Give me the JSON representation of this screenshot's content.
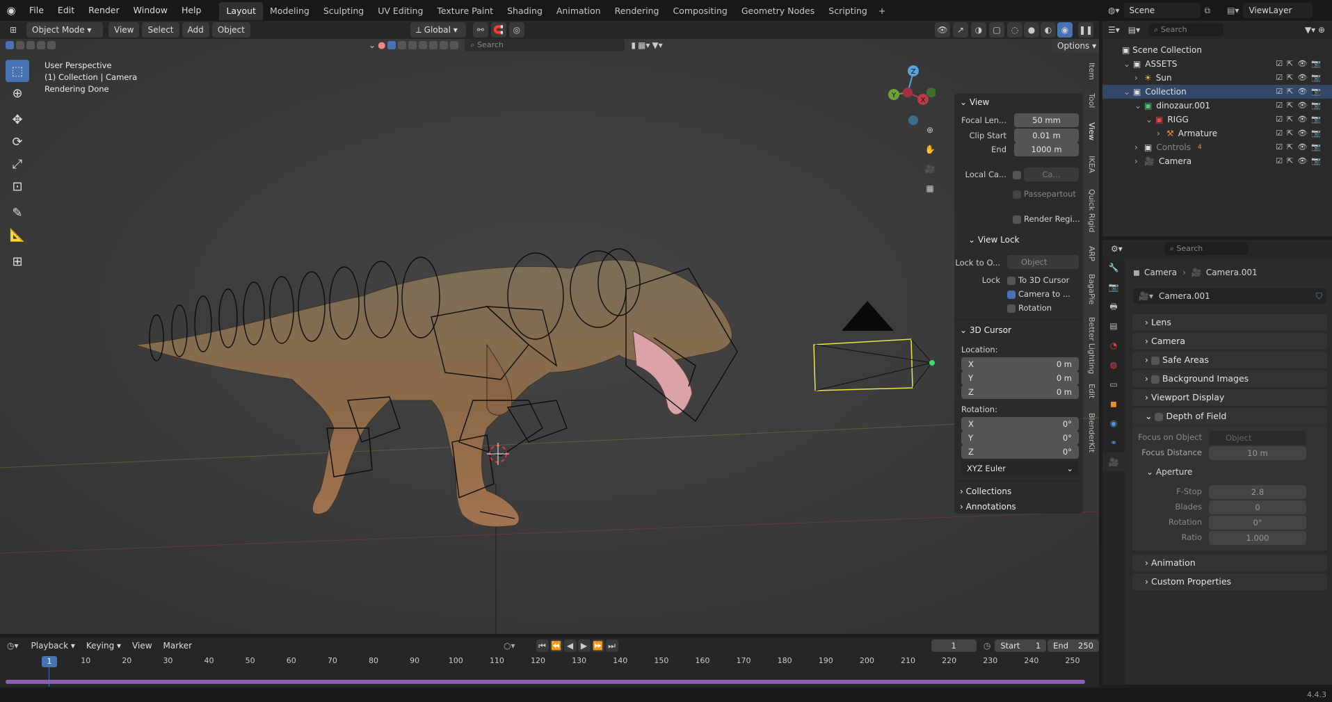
{
  "menu": {
    "items": [
      "File",
      "Edit",
      "Render",
      "Window",
      "Help"
    ]
  },
  "workspaces": [
    "Layout",
    "Modeling",
    "Sculpting",
    "UV Editing",
    "Texture Paint",
    "Shading",
    "Animation",
    "Rendering",
    "Compositing",
    "Geometry Nodes",
    "Scripting"
  ],
  "workspace_add": "+",
  "topright": {
    "scene": "Scene",
    "viewlayer": "ViewLayer"
  },
  "viewport_header": {
    "mode": "Object Mode",
    "menus": [
      "View",
      "Select",
      "Add",
      "Object"
    ],
    "orientation": "Global",
    "options": "Options",
    "search_placeholder": "Search"
  },
  "overlay_info": {
    "line1": "User Perspective",
    "line2": "(1) Collection | Camera",
    "line3": "Rendering Done"
  },
  "gizmo": {
    "z": "Z",
    "y": "Y",
    "x": "X"
  },
  "npanel": {
    "view_title": "View",
    "focal_label": "Focal Len...",
    "focal_value": "50 mm",
    "clip_start_label": "Clip Start",
    "clip_start_value": "0.01 m",
    "clip_end_label": "End",
    "clip_end_value": "1000 m",
    "local_cam_label": "Local Ca...",
    "local_cam_value": "Ca...",
    "passepartout": "Passepartout",
    "render_region": "Render Regi...",
    "view_lock_title": "View Lock",
    "lock_to_label": "Lock to O...",
    "lock_to_value": "Object",
    "lock_label": "Lock",
    "to_cursor": "To 3D Cursor",
    "camera_to": "Camera to ...",
    "rotation": "Rotation",
    "cursor_title": "3D Cursor",
    "location_label": "Location:",
    "loc_x_label": "X",
    "loc_x": "0 m",
    "loc_y_label": "Y",
    "loc_y": "0 m",
    "loc_z_label": "Z",
    "loc_z": "0 m",
    "rotation_label": "Rotation:",
    "rot_x_label": "X",
    "rot_x": "0°",
    "rot_y_label": "Y",
    "rot_y": "0°",
    "rot_z_label": "Z",
    "rot_z": "0°",
    "euler": "XYZ Euler",
    "collections": "Collections",
    "annotations": "Annotations"
  },
  "sidetabs": [
    "Item",
    "Tool",
    "View",
    "IKEA",
    "Quick Rigid",
    "ARP",
    "BagaPie",
    "Better Lighting",
    "Edit",
    "BlenderKit"
  ],
  "outliner": {
    "search_placeholder": "Search",
    "scene_collection": "Scene Collection",
    "items": [
      {
        "name": "ASSETS",
        "indent": 1
      },
      {
        "name": "Sun",
        "indent": 2
      },
      {
        "name": "Collection",
        "indent": 1
      },
      {
        "name": "dinozaur.001",
        "indent": 2
      },
      {
        "name": "RIGG",
        "indent": 3
      },
      {
        "name": "Armature",
        "indent": 4
      },
      {
        "name": "Controls",
        "indent": 2
      },
      {
        "name": "Camera",
        "indent": 2
      }
    ],
    "controls_count": "4"
  },
  "properties": {
    "search_placeholder": "Search",
    "breadcrumb_obj": "Camera",
    "breadcrumb_data": "Camera.001",
    "datablock": "Camera.001",
    "sections": [
      "Lens",
      "Camera",
      "Safe Areas",
      "Background Images",
      "Viewport Display",
      "Depth of Field"
    ],
    "focus_object_label": "Focus on Object",
    "focus_object_value": "Object",
    "focus_distance_label": "Focus Distance",
    "focus_distance_value": "10 m",
    "aperture": "Aperture",
    "fstop_label": "F-Stop",
    "fstop_value": "2.8",
    "blades_label": "Blades",
    "blades_value": "0",
    "rotation_label": "Rotation",
    "rotation_value": "0°",
    "ratio_label": "Ratio",
    "ratio_value": "1.000",
    "animation": "Animation",
    "custom_props": "Custom Properties"
  },
  "timeline": {
    "menus": [
      "Playback",
      "Keying",
      "View",
      "Marker"
    ],
    "current_frame": "1",
    "start_label": "Start",
    "start_value": "1",
    "end_label": "End",
    "end_value": "250",
    "ticks": [
      "10",
      "20",
      "30",
      "40",
      "50",
      "60",
      "70",
      "80",
      "90",
      "100",
      "110",
      "120",
      "130",
      "140",
      "150",
      "160",
      "170",
      "180",
      "190",
      "200",
      "210",
      "220",
      "230",
      "240",
      "250"
    ],
    "playhead": "1"
  },
  "status": {
    "version": "4.4.3"
  },
  "colors": {
    "accent": "#4772b3",
    "selection": "#e8e842",
    "timeline_range": "#8a5fb0",
    "xaxis": "#c0394b",
    "yaxis": "#6a9a2e"
  }
}
